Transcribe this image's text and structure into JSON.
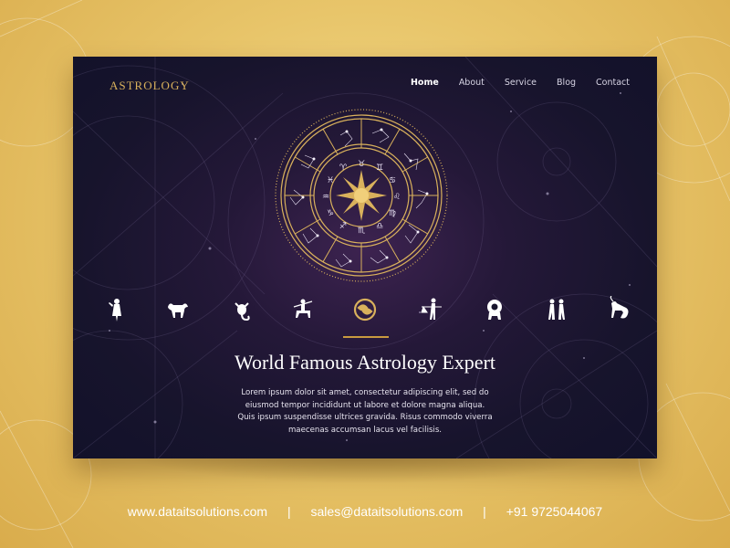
{
  "brand": {
    "logo": "ASTROLOGY"
  },
  "nav": {
    "items": [
      {
        "label": "Home",
        "active": true
      },
      {
        "label": "About",
        "active": false
      },
      {
        "label": "Service",
        "active": false
      },
      {
        "label": "Blog",
        "active": false
      },
      {
        "label": "Contact",
        "active": false
      }
    ]
  },
  "zodiac_signs": [
    {
      "name": "virgo-icon"
    },
    {
      "name": "taurus-icon"
    },
    {
      "name": "scorpio-icon"
    },
    {
      "name": "sagittarius-icon"
    },
    {
      "name": "pisces-icon",
      "active": true
    },
    {
      "name": "libra-icon"
    },
    {
      "name": "leo-icon"
    },
    {
      "name": "gemini-icon"
    },
    {
      "name": "capricorn-icon"
    }
  ],
  "hero": {
    "headline": "World Famous Astrology Expert",
    "body_lines": [
      "Lorem ipsum dolor sit amet, consectetur adipiscing elit, sed do",
      "eiusmod tempor incididunt ut labore et dolore magna aliqua.",
      "Quis ipsum suspendisse ultrices gravida. Risus commodo viverra",
      "maecenas accumsan lacus vel facilisis."
    ]
  },
  "footer": {
    "website": "www.dataitsolutions.com",
    "email": "sales@dataitsolutions.com",
    "phone": "+91 9725044067",
    "separator": "|"
  },
  "colors": {
    "gold": "#d9b15c",
    "card_bg": "#17142c",
    "accent_glow": "#3d2350"
  }
}
